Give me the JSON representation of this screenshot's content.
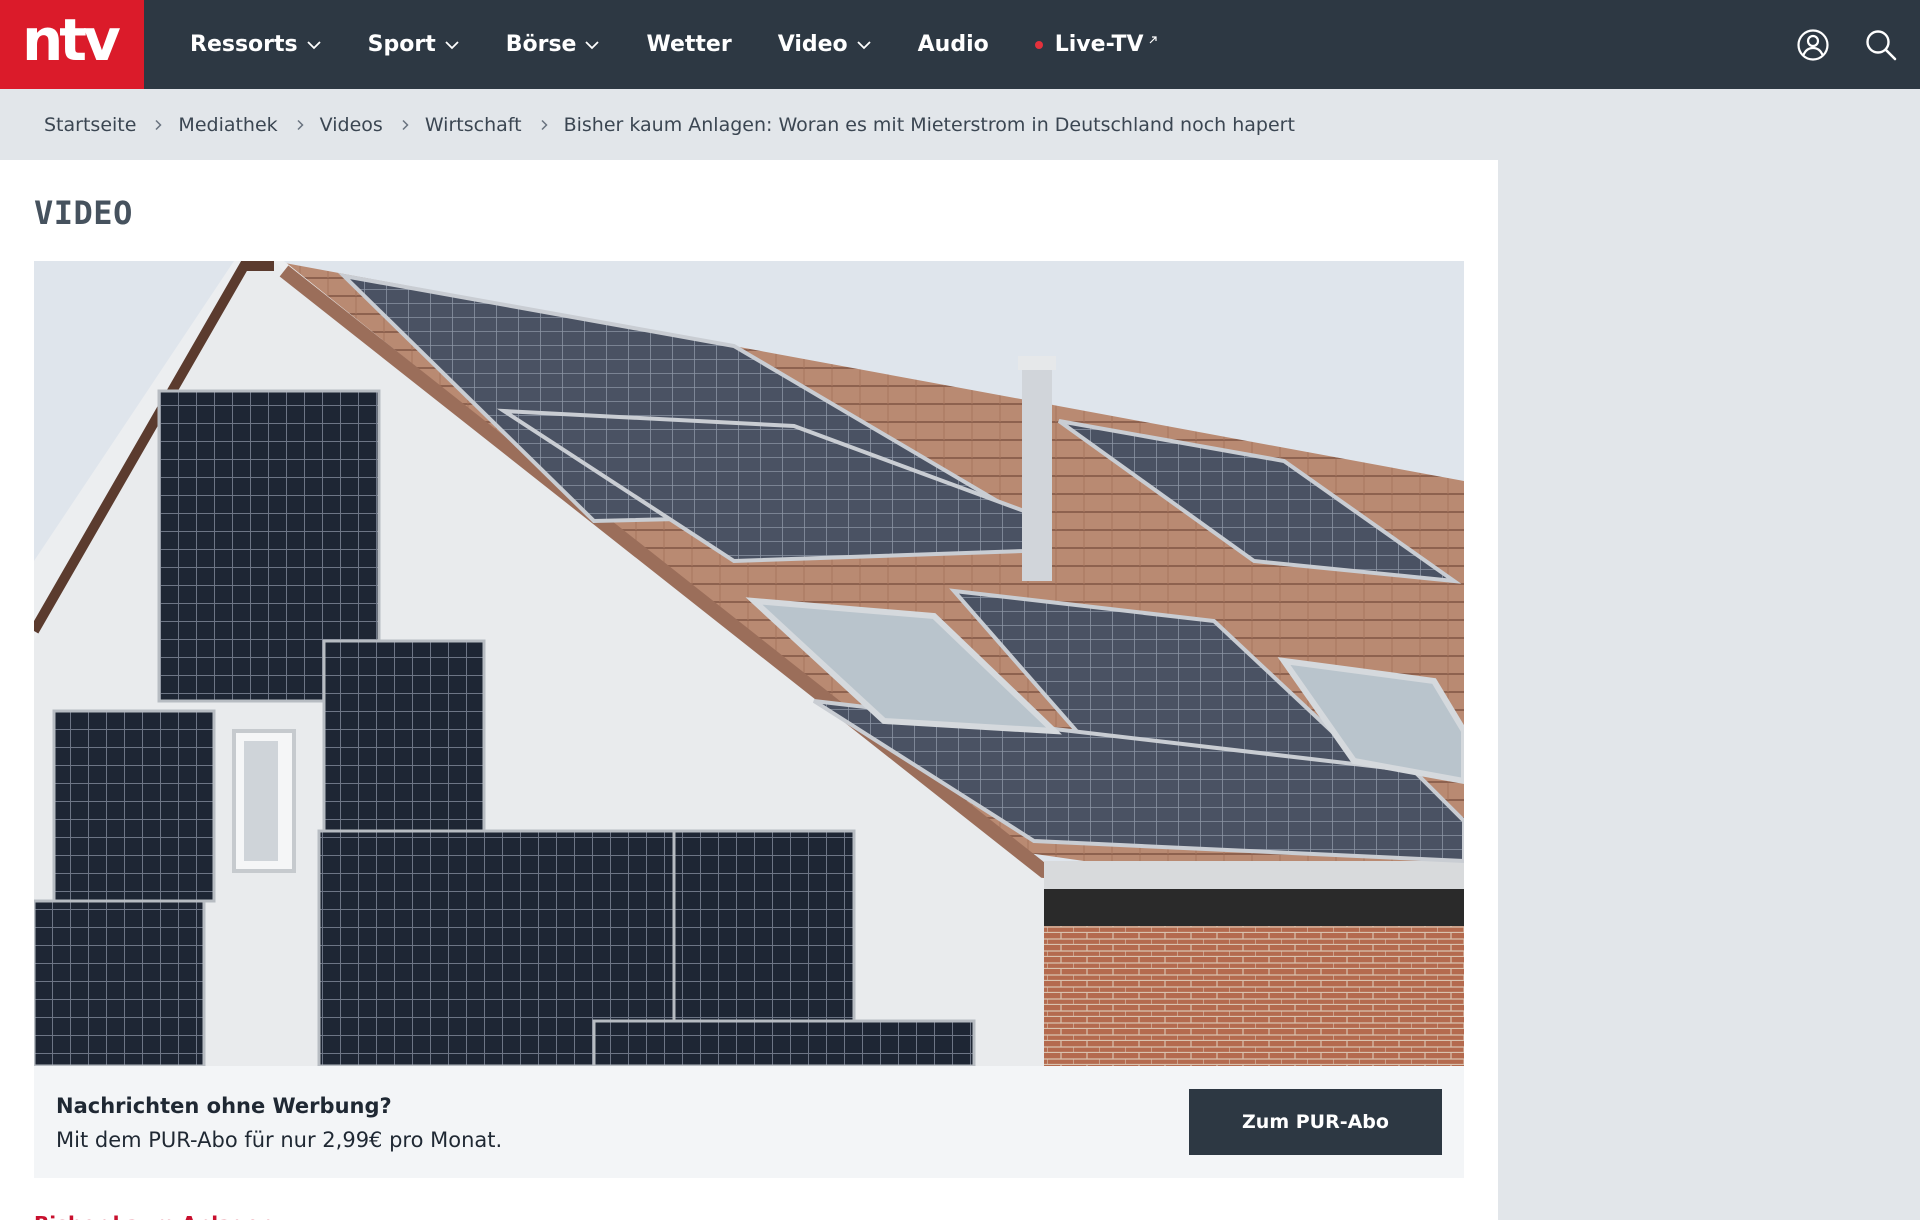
{
  "brand": {
    "logo_text": "ntv",
    "accent": "#db1b2a",
    "nav_bg": "#2d3843"
  },
  "nav": {
    "items": [
      {
        "label": "Ressorts",
        "dropdown": true
      },
      {
        "label": "Sport",
        "dropdown": true
      },
      {
        "label": "Börse",
        "dropdown": true
      },
      {
        "label": "Wetter",
        "dropdown": false
      },
      {
        "label": "Video",
        "dropdown": true
      },
      {
        "label": "Audio",
        "dropdown": false
      }
    ],
    "live": {
      "label": "Live-TV",
      "dot_color": "#e3313c"
    },
    "icons": [
      "user-icon",
      "search-icon"
    ]
  },
  "breadcrumb": [
    "Startseite",
    "Mediathek",
    "Videos",
    "Wirtschaft",
    "Bisher kaum Anlagen: Woran es mit Mieterstrom in Deutschland noch hapert"
  ],
  "main": {
    "section_title": "VIDEO",
    "promo": {
      "title": "Nachrichten ohne Werbung?",
      "subtitle": "Mit dem PUR-Abo für nur 2,99€ pro Monat.",
      "button_label": "Zum PUR-Abo"
    },
    "partial_link": "Bisher kaum Anlagen"
  }
}
